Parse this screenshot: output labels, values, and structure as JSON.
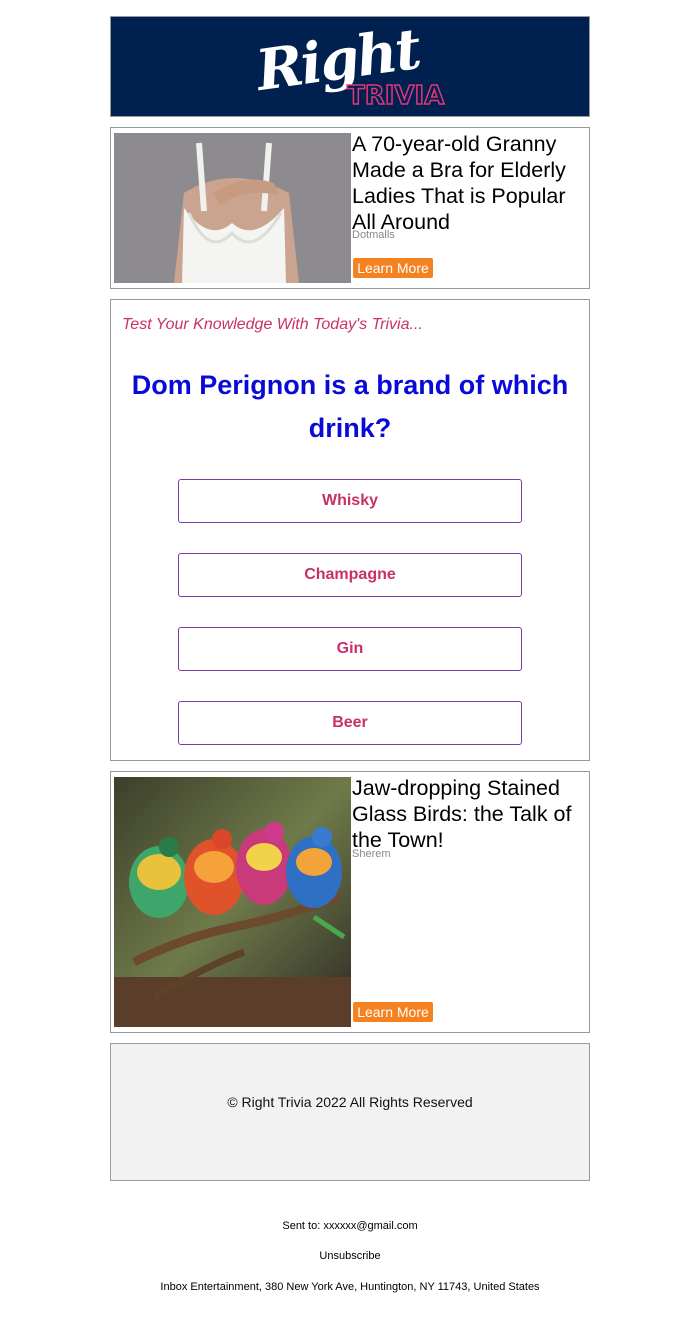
{
  "header": {
    "logo_text_1": "Right",
    "logo_text_2": "TRIVIA"
  },
  "ad_top": {
    "title": "A 70-year-old Granny Made a Bra for Elderly Ladies That is Popular All Around",
    "source": "Dotmalls",
    "button": "Learn More",
    "image": "woman-white-bra-photo"
  },
  "quiz": {
    "intro": "Test Your Knowledge With Today's Trivia...",
    "question": "Dom Perignon is a brand of which drink?",
    "answers": [
      "Whisky",
      "Champagne",
      "Gin",
      "Beer"
    ]
  },
  "ad_bottom": {
    "title": "Jaw-dropping Stained Glass Birds: the Talk of the Town!",
    "source": "Sherem",
    "button": "Learn More",
    "image": "stained-glass-birds-photo"
  },
  "footer": {
    "copyright": "© Right Trivia 2022 All Rights Reserved",
    "sent_to": "Sent to: xxxxxx@gmail.com",
    "unsubscribe": "Unsubscribe",
    "address": "Inbox Entertainment, 380 New York Ave, Huntington, NY 11743, United States"
  },
  "colors": {
    "header_bg": "#00214f",
    "accent_pink": "#c9306a",
    "question_blue": "#0a0ad8",
    "button_orange": "#f58220"
  }
}
